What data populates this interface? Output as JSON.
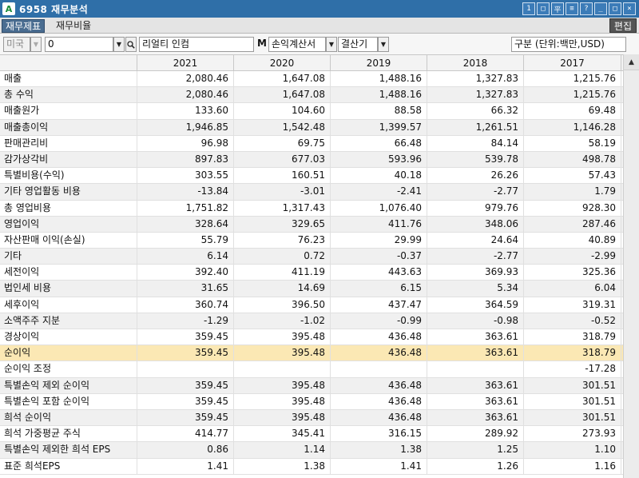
{
  "window": {
    "title": "6958 재무분석",
    "app_icon": "A",
    "buttons": [
      "1",
      "□",
      "平",
      "≡",
      "?",
      "_",
      "□",
      "×"
    ]
  },
  "tabs": [
    {
      "label": "재무제표",
      "active": true
    },
    {
      "label": "재무비율",
      "active": false
    }
  ],
  "edit_label": "편집",
  "filters": {
    "country": "미국",
    "code": "0",
    "company": "리얼티 인컴",
    "m_label": "M",
    "statement": "손익계산서",
    "period": "결산기",
    "unit": "구분 (단위:백만,USD)"
  },
  "table": {
    "years": [
      "2021",
      "2020",
      "2019",
      "2018",
      "2017"
    ],
    "rows": [
      {
        "label": "매출",
        "values": [
          "2,080.46",
          "1,647.08",
          "1,488.16",
          "1,327.83",
          "1,215.76"
        ]
      },
      {
        "label": "총 수익",
        "values": [
          "2,080.46",
          "1,647.08",
          "1,488.16",
          "1,327.83",
          "1,215.76"
        ]
      },
      {
        "label": "매출원가",
        "values": [
          "133.60",
          "104.60",
          "88.58",
          "66.32",
          "69.48"
        ]
      },
      {
        "label": "매출총이익",
        "values": [
          "1,946.85",
          "1,542.48",
          "1,399.57",
          "1,261.51",
          "1,146.28"
        ]
      },
      {
        "label": "판매관리비",
        "values": [
          "96.98",
          "69.75",
          "66.48",
          "84.14",
          "58.19"
        ]
      },
      {
        "label": "감가상각비",
        "values": [
          "897.83",
          "677.03",
          "593.96",
          "539.78",
          "498.78"
        ]
      },
      {
        "label": "특별비용(수익)",
        "values": [
          "303.55",
          "160.51",
          "40.18",
          "26.26",
          "57.43"
        ]
      },
      {
        "label": "기타 영업활동 비용",
        "values": [
          "-13.84",
          "-3.01",
          "-2.41",
          "-2.77",
          "1.79"
        ]
      },
      {
        "label": "총 영업비용",
        "values": [
          "1,751.82",
          "1,317.43",
          "1,076.40",
          "979.76",
          "928.30"
        ]
      },
      {
        "label": "영업이익",
        "values": [
          "328.64",
          "329.65",
          "411.76",
          "348.06",
          "287.46"
        ]
      },
      {
        "label": "자산판매 이익(손실)",
        "values": [
          "55.79",
          "76.23",
          "29.99",
          "24.64",
          "40.89"
        ]
      },
      {
        "label": "기타",
        "values": [
          "6.14",
          "0.72",
          "-0.37",
          "-2.77",
          "-2.99"
        ]
      },
      {
        "label": "세전이익",
        "values": [
          "392.40",
          "411.19",
          "443.63",
          "369.93",
          "325.36"
        ]
      },
      {
        "label": "법인세 비용",
        "values": [
          "31.65",
          "14.69",
          "6.15",
          "5.34",
          "6.04"
        ]
      },
      {
        "label": "세후이익",
        "values": [
          "360.74",
          "396.50",
          "437.47",
          "364.59",
          "319.31"
        ]
      },
      {
        "label": "소액주주 지분",
        "values": [
          "-1.29",
          "-1.02",
          "-0.99",
          "-0.98",
          "-0.52"
        ]
      },
      {
        "label": "경상이익",
        "values": [
          "359.45",
          "395.48",
          "436.48",
          "363.61",
          "318.79"
        ]
      },
      {
        "label": "순이익",
        "values": [
          "359.45",
          "395.48",
          "436.48",
          "363.61",
          "318.79"
        ],
        "highlight": true
      },
      {
        "label": "순이익 조정",
        "values": [
          "",
          "",
          "",
          "",
          "-17.28"
        ]
      },
      {
        "label": "특별손익 제외 순이익",
        "values": [
          "359.45",
          "395.48",
          "436.48",
          "363.61",
          "301.51"
        ]
      },
      {
        "label": "특별손익 포함 순이익",
        "values": [
          "359.45",
          "395.48",
          "436.48",
          "363.61",
          "301.51"
        ]
      },
      {
        "label": "희석 순이익",
        "values": [
          "359.45",
          "395.48",
          "436.48",
          "363.61",
          "301.51"
        ]
      },
      {
        "label": "희석 가중평균 주식",
        "values": [
          "414.77",
          "345.41",
          "316.15",
          "289.92",
          "273.93"
        ]
      },
      {
        "label": "특별손익 제외한 희석 EPS",
        "values": [
          "0.86",
          "1.14",
          "1.38",
          "1.25",
          "1.10"
        ]
      },
      {
        "label": "표준 희석EPS",
        "values": [
          "1.41",
          "1.38",
          "1.41",
          "1.26",
          "1.16"
        ]
      }
    ]
  },
  "colors": {
    "titlebar": "#2f6fa8",
    "active_tab": "#4a6d91",
    "highlight_row": "#fbe8b4",
    "alt_row": "#f0f0f0"
  }
}
